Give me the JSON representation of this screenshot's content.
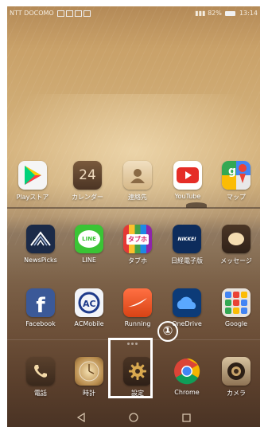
{
  "status_bar": {
    "carrier": "NTT DOCOMO",
    "battery": "82%",
    "time": "13:14"
  },
  "apps": [
    {
      "label": "Playストア",
      "icon": "play-store-icon"
    },
    {
      "label": "カレンダー",
      "icon": "calendar-icon",
      "date_number": "24"
    },
    {
      "label": "連絡先",
      "icon": "contacts-icon"
    },
    {
      "label": "YouTube",
      "icon": "youtube-icon"
    },
    {
      "label": "マップ",
      "icon": "maps-icon"
    },
    {
      "label": "NewsPicks",
      "icon": "newspicks-icon"
    },
    {
      "label": "LINE",
      "icon": "line-icon",
      "badge_text": "LINE"
    },
    {
      "label": "タブホ",
      "icon": "tabuho-icon",
      "badge_text": "タブホ"
    },
    {
      "label": "日経電子版",
      "icon": "nikkei-icon",
      "badge_text": "NIKKEI"
    },
    {
      "label": "メッセージ",
      "icon": "message-icon"
    },
    {
      "label": "Facebook",
      "icon": "facebook-icon"
    },
    {
      "label": "ACMobile",
      "icon": "acmobile-icon"
    },
    {
      "label": "Running",
      "icon": "running-icon"
    },
    {
      "label": "OneDrive",
      "icon": "onedrive-icon"
    },
    {
      "label": "Google",
      "icon": "google-folder-icon"
    }
  ],
  "dock": [
    {
      "label": "電話",
      "icon": "phone-icon"
    },
    {
      "label": "時計",
      "icon": "clock-icon"
    },
    {
      "label": "設定",
      "icon": "settings-gear-icon"
    },
    {
      "label": "Chrome",
      "icon": "chrome-icon"
    },
    {
      "label": "カメラ",
      "icon": "camera-icon"
    }
  ],
  "annotation": {
    "marker": "①",
    "target": "設定"
  },
  "nav_bar": [
    "back-icon",
    "home-icon",
    "recents-icon"
  ],
  "colors": {
    "highlight": "#ffffff",
    "label": "#ffffff"
  }
}
